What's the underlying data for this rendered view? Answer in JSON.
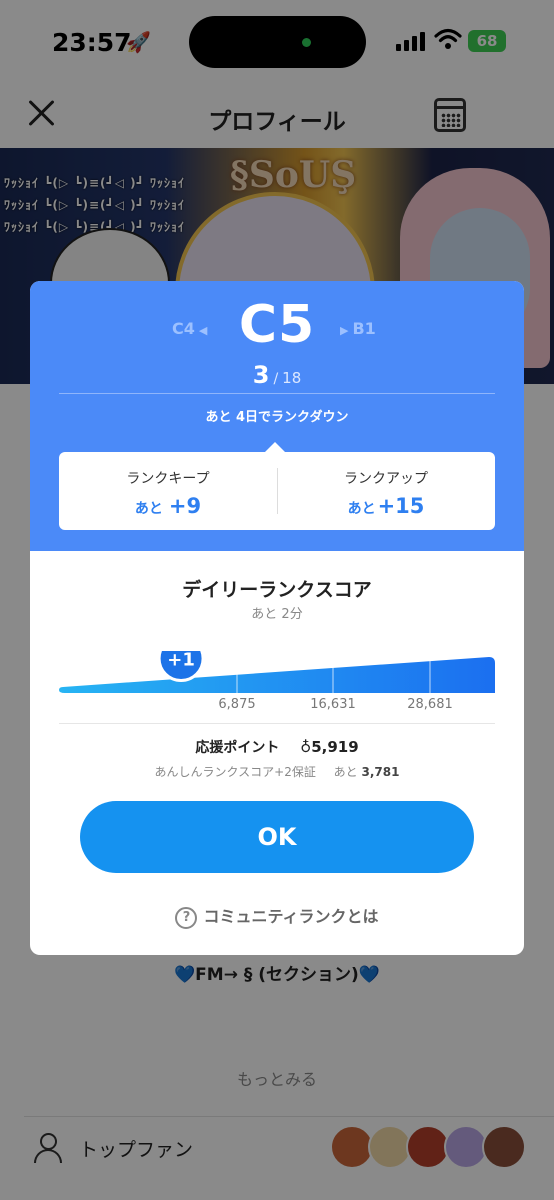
{
  "status_bar": {
    "time": "23:57",
    "battery": "68"
  },
  "nav": {
    "title": "プロフィール"
  },
  "banner": {
    "logo_text": "§SoUŞ",
    "text_line": "ﾜｯｼｮｲ ┗(▷ ┗)≡(┛◁ )┛ ﾜｯｼｮｲ"
  },
  "profile": {
    "section_label": "💙FM→ § (セクション)💙",
    "more_label": "もっとみる",
    "top_fans_label": "トップファン"
  },
  "modal": {
    "prev_rank": "C4",
    "current_rank": "C5",
    "next_rank": "B1",
    "position": "3",
    "total": "18",
    "rank_down_message": "あと 4日でランクダウン",
    "keep": {
      "title": "ランクキープ",
      "prefix": "あと",
      "value": "+9"
    },
    "up": {
      "title": "ランクアップ",
      "prefix": "あと",
      "value": "+15"
    },
    "daily_title": "デイリーランクスコア",
    "daily_sub": "あと 2分",
    "progress_badge": "+1",
    "progress_fraction": 0.28,
    "ticks": [
      "6,875",
      "16,631",
      "28,681"
    ],
    "support_label": "応援ポイント",
    "support_points": "5,919",
    "assure_text": "あんしんランクスコア+2保証",
    "assure_remain_label": "あと",
    "assure_remain_value": "3,781",
    "ok_label": "OK",
    "help_label": "コミュニティランクとは"
  },
  "colors": {
    "accent": "#4b8af8",
    "button": "#1592f0",
    "value": "#2e7ff0"
  }
}
